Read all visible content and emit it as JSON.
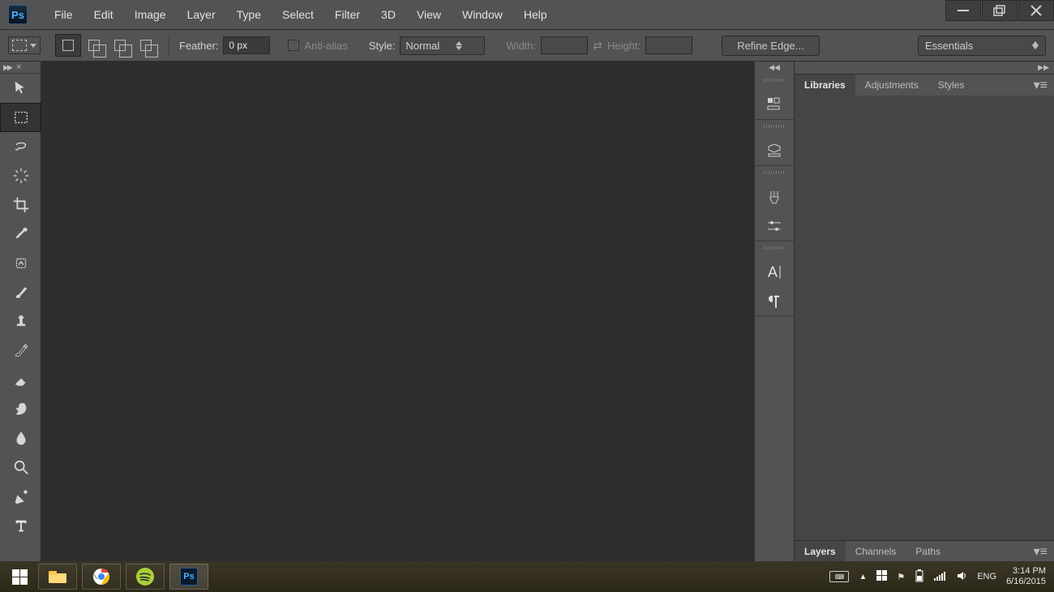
{
  "app_logo_text": "Ps",
  "menu": [
    "File",
    "Edit",
    "Image",
    "Layer",
    "Type",
    "Select",
    "Filter",
    "3D",
    "View",
    "Window",
    "Help"
  ],
  "options": {
    "feather_label": "Feather:",
    "feather_value": "0 px",
    "antialias_label": "Anti-alias",
    "style_label": "Style:",
    "style_value": "Normal",
    "width_label": "Width:",
    "width_value": "",
    "height_label": "Height:",
    "height_value": "",
    "refine_label": "Refine Edge...",
    "workspace_label": "Essentials"
  },
  "panels_right": {
    "tabs1": [
      "Libraries",
      "Adjustments",
      "Styles"
    ],
    "tabs2": [
      "Layers",
      "Channels",
      "Paths"
    ]
  },
  "taskbar": {
    "lang": "ENG",
    "time": "3:14 PM",
    "date": "6/16/2015"
  }
}
